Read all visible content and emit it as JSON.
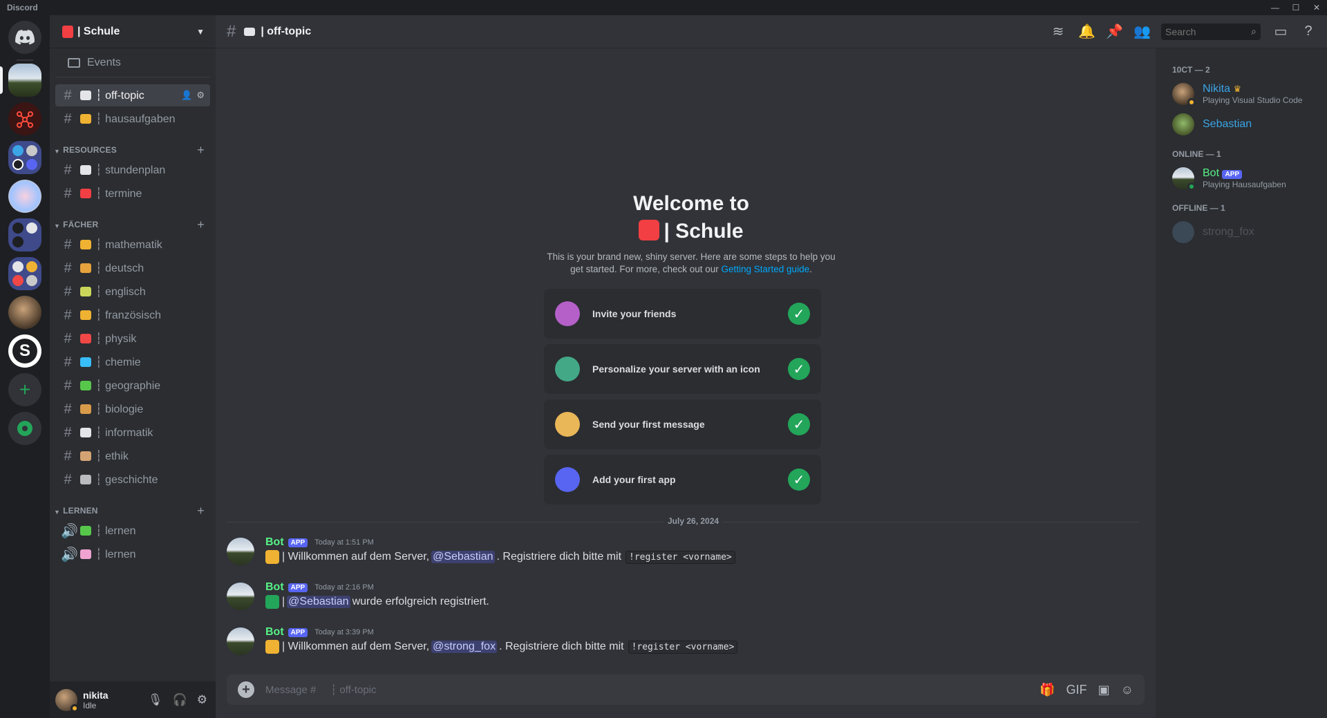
{
  "app": {
    "title": "Discord"
  },
  "window_controls": {
    "minimize": "—",
    "maximize": "☐",
    "close": "✕"
  },
  "guild": {
    "name": "| Schule"
  },
  "events": {
    "label": "Events"
  },
  "channels_top": [
    {
      "name": "┆ off-topic",
      "emoji_color": "#e3e5e8"
    },
    {
      "name": "┆ hausaufgaben",
      "emoji_color": "#f0b232"
    }
  ],
  "categories": [
    {
      "label": "RESOURCES",
      "channels": [
        {
          "name": "┆ stundenplan",
          "emoji_color": "#e3e5e8"
        },
        {
          "name": "┆ termine",
          "emoji_color": "#f23f43"
        }
      ]
    },
    {
      "label": "FÄCHER",
      "channels": [
        {
          "name": "┆ mathematik",
          "emoji_color": "#f0b232"
        },
        {
          "name": "┆ deutsch",
          "emoji_color": "#e6a23c"
        },
        {
          "name": "┆ englisch",
          "emoji_color": "#c9d65b"
        },
        {
          "name": "┆ französisch",
          "emoji_color": "#f0b232"
        },
        {
          "name": "┆ physik",
          "emoji_color": "#f04747"
        },
        {
          "name": "┆ chemie",
          "emoji_color": "#38bdf8"
        },
        {
          "name": "┆ geographie",
          "emoji_color": "#57c74b"
        },
        {
          "name": "┆ biologie",
          "emoji_color": "#d89b4a"
        },
        {
          "name": "┆ informatik",
          "emoji_color": "#e3e5e8"
        },
        {
          "name": "┆ ethik",
          "emoji_color": "#d4a373"
        },
        {
          "name": "┆ geschichte",
          "emoji_color": "#b9bbbe"
        }
      ]
    },
    {
      "label": "LERNEN",
      "channels": [
        {
          "name": "┆ lernen",
          "emoji_color": "#57c74b"
        },
        {
          "name": "┆ lernen",
          "emoji_color": "#f0a3d0"
        }
      ]
    }
  ],
  "user": {
    "name": "nikita",
    "status": "Idle"
  },
  "channel_header": {
    "title": "| off-topic",
    "search_placeholder": "Search"
  },
  "welcome": {
    "title_line1": "Welcome to",
    "title_line2": "| Schule",
    "desc": "This is your brand new, shiny server. Here are some steps to help you get started. For more, check out our ",
    "guide_link": "Getting Started guide",
    "period": "."
  },
  "steps": [
    {
      "label": "Invite your friends",
      "color": "#b560c9"
    },
    {
      "label": "Personalize your server with an icon",
      "color": "#43a886"
    },
    {
      "label": "Send your first message",
      "color": "#e9b658"
    },
    {
      "label": "Add your first app",
      "color": "#5865f2"
    }
  ],
  "date_divider": "July 26, 2024",
  "messages": [
    {
      "author": "Bot",
      "badge": "APP",
      "time": "Today at 1:51 PM",
      "pre": "| Willkommen auf dem Server,",
      "mention": "@Sebastian",
      "post": ". Registriere dich bitte mit",
      "code": "!register <vorname>"
    },
    {
      "author": "Bot",
      "badge": "APP",
      "time": "Today at 2:16 PM",
      "pre": "|",
      "mention": "@Sebastian",
      "post": "wurde erfolgreich registriert.",
      "code": ""
    },
    {
      "author": "Bot",
      "badge": "APP",
      "time": "Today at 3:39 PM",
      "pre": "| Willkommen auf dem Server,",
      "mention": "@strong_fox",
      "post": ". Registriere dich bitte mit",
      "code": "!register <vorname>"
    }
  ],
  "composer": {
    "placeholder": "Message #     ┆ off-topic"
  },
  "member_groups": [
    {
      "label": "10CT — 2",
      "members": [
        {
          "name": "Nikita",
          "sub": "Playing Visual Studio Code",
          "color": "#3ba5e6",
          "status": "#f0b232"
        },
        {
          "name": "Sebastian",
          "sub": "",
          "color": "#3ba5e6",
          "status": ""
        }
      ]
    },
    {
      "label": "ONLINE — 1",
      "members": [
        {
          "name": "Bot",
          "badge": "APP",
          "sub": "Playing Hausaufgaben",
          "color": "#57f287",
          "status": "#23a55a"
        }
      ]
    },
    {
      "label": "OFFLINE — 1",
      "members": [
        {
          "name": "strong_fox",
          "sub": "",
          "color": "#949ba4",
          "status": ""
        }
      ]
    }
  ]
}
